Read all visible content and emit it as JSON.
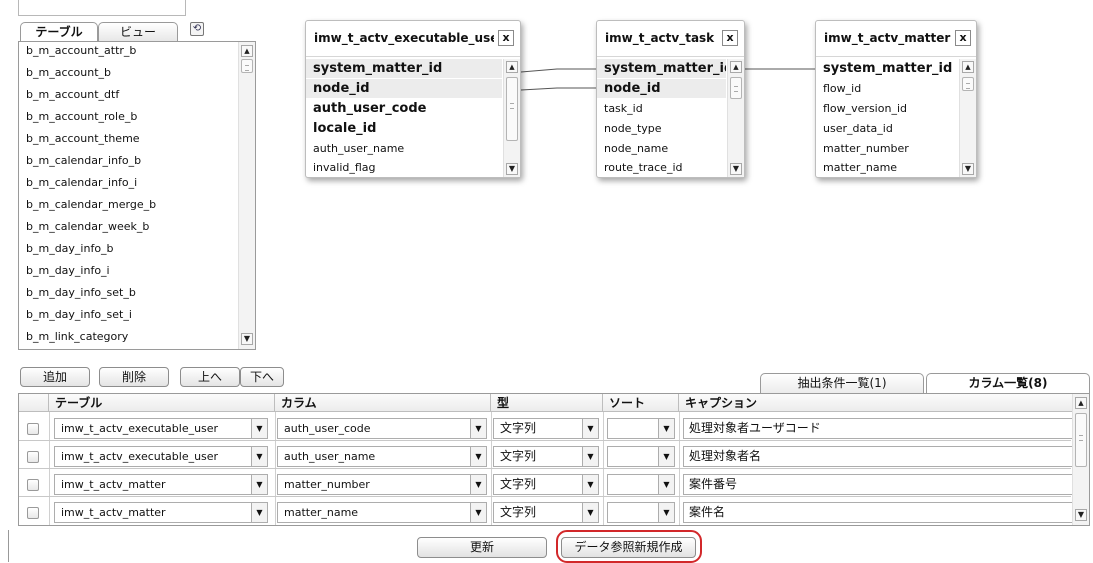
{
  "left_panel": {
    "tabs": [
      "テーブル",
      "ビュー"
    ],
    "tables": [
      "b_m_account_attr_b",
      "b_m_account_b",
      "b_m_account_dtf",
      "b_m_account_role_b",
      "b_m_account_theme",
      "b_m_calendar_info_b",
      "b_m_calendar_info_i",
      "b_m_calendar_merge_b",
      "b_m_calendar_week_b",
      "b_m_day_info_b",
      "b_m_day_info_i",
      "b_m_day_info_set_b",
      "b_m_day_info_set_i",
      "b_m_link_category"
    ]
  },
  "entities": [
    {
      "title": "imw_t_actv_executable_user",
      "columns": [
        {
          "name": "system_matter_id",
          "key": true,
          "selected": true
        },
        {
          "name": "node_id",
          "key": true,
          "selected": true
        },
        {
          "name": "auth_user_code",
          "key": true,
          "selected": false
        },
        {
          "name": "locale_id",
          "key": true,
          "selected": false
        },
        {
          "name": "auth_user_name",
          "key": false,
          "selected": false
        },
        {
          "name": "invalid_flag",
          "key": false,
          "selected": false
        }
      ]
    },
    {
      "title": "imw_t_actv_task",
      "columns": [
        {
          "name": "system_matter_id",
          "key": true,
          "selected": true
        },
        {
          "name": "node_id",
          "key": true,
          "selected": true
        },
        {
          "name": "task_id",
          "key": false,
          "selected": false
        },
        {
          "name": "node_type",
          "key": false,
          "selected": false
        },
        {
          "name": "node_name",
          "key": false,
          "selected": false
        },
        {
          "name": "route_trace_id",
          "key": false,
          "selected": false
        }
      ]
    },
    {
      "title": "imw_t_actv_matter",
      "columns": [
        {
          "name": "system_matter_id",
          "key": true,
          "selected": false
        },
        {
          "name": "flow_id",
          "key": false,
          "selected": false
        },
        {
          "name": "flow_version_id",
          "key": false,
          "selected": false
        },
        {
          "name": "user_data_id",
          "key": false,
          "selected": false
        },
        {
          "name": "matter_number",
          "key": false,
          "selected": false
        },
        {
          "name": "matter_name",
          "key": false,
          "selected": false
        }
      ]
    }
  ],
  "close_glyph": "x",
  "toolbar": {
    "add": "追加",
    "delete": "削除",
    "up": "上へ",
    "down": "下へ"
  },
  "right_tabs": {
    "conditions": "抽出条件一覧(1)",
    "columns": "カラム一覧(8)"
  },
  "grid": {
    "headers": [
      "テーブル",
      "カラム",
      "型",
      "ソート",
      "キャプション"
    ],
    "rows": [
      {
        "table": "imw_t_actv_executable_user",
        "column": "auth_user_code",
        "type": "文字列",
        "sort": "",
        "caption": "処理対象者ユーザコード"
      },
      {
        "table": "imw_t_actv_executable_user",
        "column": "auth_user_name",
        "type": "文字列",
        "sort": "",
        "caption": "処理対象者名"
      },
      {
        "table": "imw_t_actv_matter",
        "column": "matter_number",
        "type": "文字列",
        "sort": "",
        "caption": "案件番号"
      },
      {
        "table": "imw_t_actv_matter",
        "column": "matter_name",
        "type": "文字列",
        "sort": "",
        "caption": "案件名"
      }
    ]
  },
  "actions": {
    "update": "更新",
    "create": "データ参照新規作成"
  },
  "colors": {
    "highlight": "#d2282a"
  }
}
